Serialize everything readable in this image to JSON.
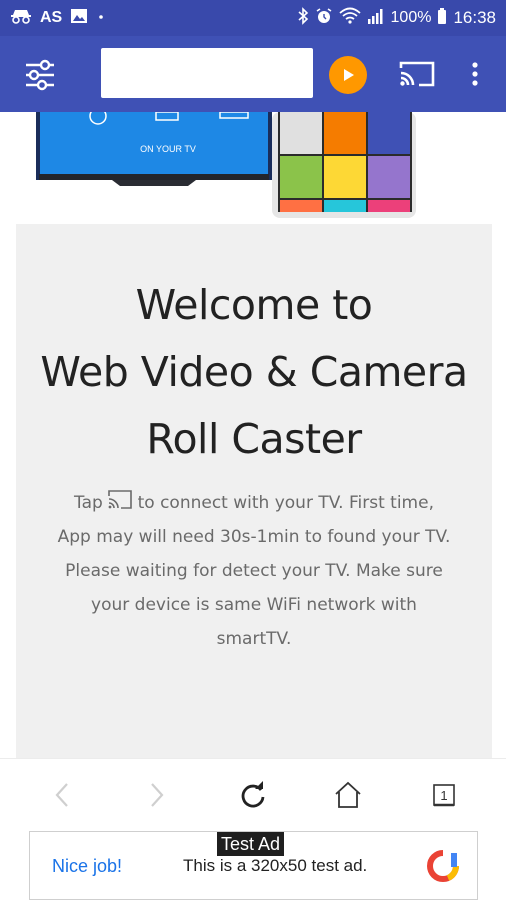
{
  "status_bar": {
    "left_text": "AS",
    "battery": "100%",
    "time": "16:38"
  },
  "toolbar": {
    "url_value": "",
    "url_placeholder": ""
  },
  "banner": {
    "tv_label": "ON YOUR TV"
  },
  "welcome": {
    "title_line1": "Welcome to",
    "title_line2": "Web Video & Camera",
    "title_line3": "Roll Caster",
    "body_prefix": "Tap",
    "body_rest": "to connect with your TV. First time,",
    "body_line2": "App may will need 30s-1min to found your TV.",
    "body_line3": "Please waiting for detect your TV. Make sure",
    "body_line4": "your device is same WiFi network with",
    "body_line5": "smartTV."
  },
  "nav": {
    "tab_count": "1"
  },
  "ad": {
    "tag": "Test Ad",
    "nice": "Nice job!",
    "text": "This is a 320x50 test ad."
  },
  "colors": {
    "status_bar": "#3949ab",
    "toolbar": "#3f51b5",
    "play_button": "#ff9800",
    "ad_link": "#1a73e8"
  }
}
